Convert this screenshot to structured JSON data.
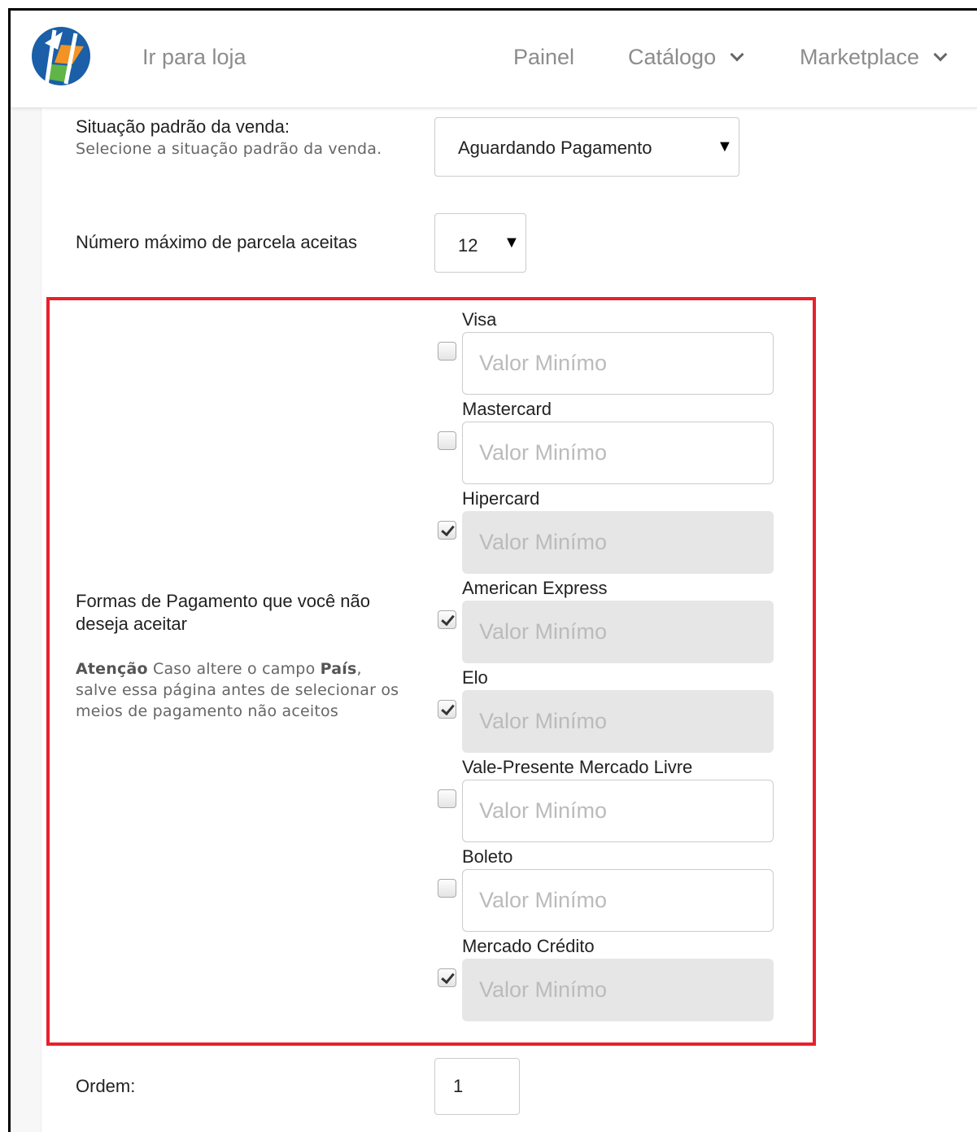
{
  "header": {
    "store_link": "Ir para loja",
    "panel_link": "Painel",
    "catalog_link": "Catálogo",
    "marketplace_link": "Marketplace",
    "logo_colors": [
      "#1a5fa8",
      "#f39323",
      "#5fb548"
    ]
  },
  "form": {
    "default_status": {
      "label": "Situação padrão da venda:",
      "help": "Selecione a situação padrão da venda.",
      "selected": "Aguardando Pagamento"
    },
    "max_installments": {
      "label": "Número máximo de parcela aceitas",
      "selected": "12"
    },
    "payment_methods": {
      "label": "Formas de Pagamento que você não deseja aceitar",
      "warning_bold_1": "Atenção",
      "warning_text_1": " Caso altere o campo ",
      "warning_bold_2": "País",
      "warning_text_2": ", salve essa página antes de selecionar os meios de pagamento não aceitos",
      "placeholder": "Valor Minímo",
      "items": [
        {
          "name": "Visa",
          "checked": false
        },
        {
          "name": "Mastercard",
          "checked": false
        },
        {
          "name": "Hipercard",
          "checked": true
        },
        {
          "name": "American Express",
          "checked": true
        },
        {
          "name": "Elo",
          "checked": true
        },
        {
          "name": "Vale-Presente Mercado Livre",
          "checked": false
        },
        {
          "name": "Boleto",
          "checked": false
        },
        {
          "name": "Mercado Crédito",
          "checked": true
        }
      ]
    },
    "order": {
      "label": "Ordem:",
      "value": "1"
    }
  },
  "colors": {
    "highlight": "#e8202a",
    "disabled_input": "#e6e6e6"
  }
}
